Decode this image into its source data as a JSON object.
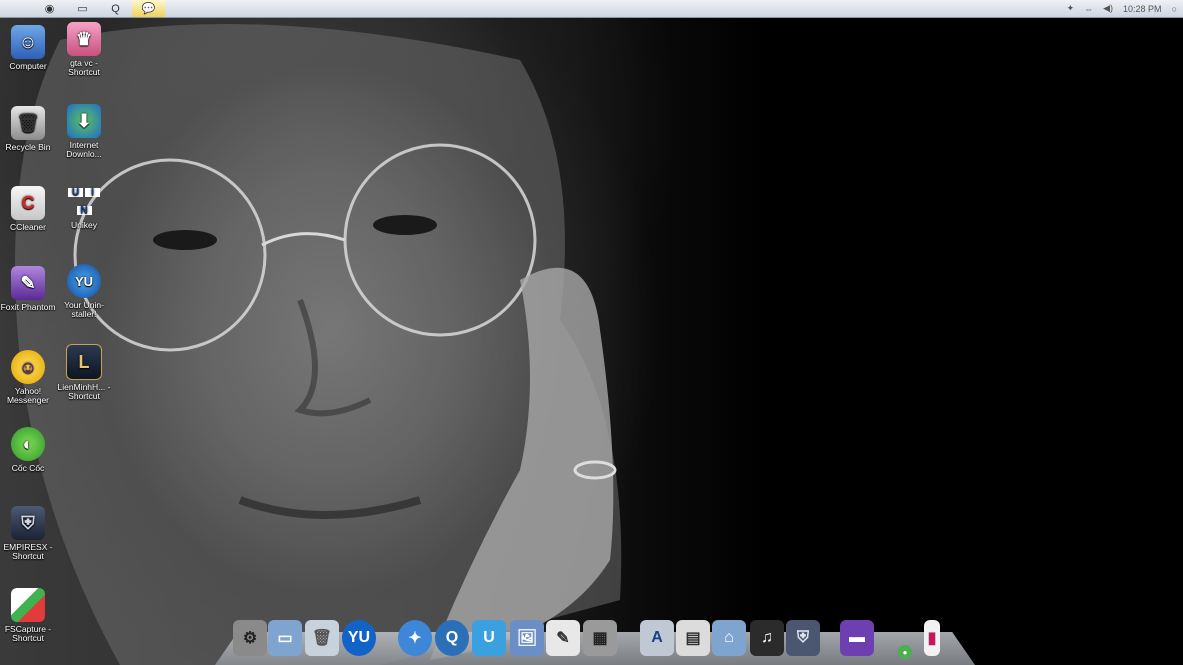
{
  "menubar": {
    "icons": [
      {
        "name": "apple-icon",
        "glyph": "",
        "active": false
      },
      {
        "name": "globe-icon",
        "glyph": "◉",
        "active": false
      },
      {
        "name": "folder-icon",
        "glyph": "▭",
        "active": false
      },
      {
        "name": "quicktime-icon",
        "glyph": "Q",
        "active": false
      },
      {
        "name": "chat-icon",
        "glyph": "💬",
        "active": true
      }
    ],
    "clock": "10:28 PM"
  },
  "desktop": {
    "icons": [
      {
        "key": "computer",
        "label": "Computer"
      },
      {
        "key": "gta",
        "label": "gta vc - Shortcut"
      },
      {
        "key": "recycle",
        "label": "Recycle Bin"
      },
      {
        "key": "idm",
        "label": "Internet Downlo..."
      },
      {
        "key": "ccleaner",
        "label": "CCleaner"
      },
      {
        "key": "unikey",
        "label": "Unikey"
      },
      {
        "key": "foxit",
        "label": "Foxit Phantom"
      },
      {
        "key": "uninstaller",
        "label": "Your Unin-staller!"
      },
      {
        "key": "yahoo",
        "label": "Yahoo! Messenger"
      },
      {
        "key": "lienminh",
        "label": "LienMinhH... - Shortcut"
      },
      {
        "key": "coccoc",
        "label": "Cốc Cốc"
      },
      {
        "key": "empiresx",
        "label": "EMPIRESX - Shortcut"
      },
      {
        "key": "fscapture",
        "label": "FSCapture - Shortcut"
      }
    ],
    "unikey_letters": [
      "U",
      "I",
      "N"
    ],
    "uninstaller_glyph": "YU",
    "lienminh_glyph": "L"
  },
  "dock": {
    "items": [
      {
        "name": "system-preferences-icon",
        "glyph": "⚙"
      },
      {
        "name": "folder-icon",
        "glyph": "▭"
      },
      {
        "name": "trash-icon",
        "glyph": "🗑"
      },
      {
        "name": "uninstaller-icon",
        "glyph": "YU"
      },
      {
        "name": "safari-icon",
        "glyph": "✦"
      },
      {
        "name": "quicktime-icon",
        "glyph": "Q"
      },
      {
        "name": "ulead-icon",
        "glyph": "U"
      },
      {
        "name": "preview-icon",
        "glyph": "🖼"
      },
      {
        "name": "textedit-icon",
        "glyph": "✎"
      },
      {
        "name": "calculator-icon",
        "glyph": "▦"
      },
      {
        "name": "app-store-icon",
        "glyph": "A"
      },
      {
        "name": "utility-icon",
        "glyph": "▤"
      },
      {
        "name": "library-folder-icon",
        "glyph": "⌂"
      },
      {
        "name": "keyboard-icon",
        "glyph": "♫"
      },
      {
        "name": "spartan-helmet-icon",
        "glyph": "⛨"
      },
      {
        "name": "wallpaper-icon",
        "glyph": "▬"
      },
      {
        "name": "coccoc-small-icon",
        "glyph": "●"
      },
      {
        "name": "stack-icon",
        "glyph": "▮"
      }
    ]
  }
}
